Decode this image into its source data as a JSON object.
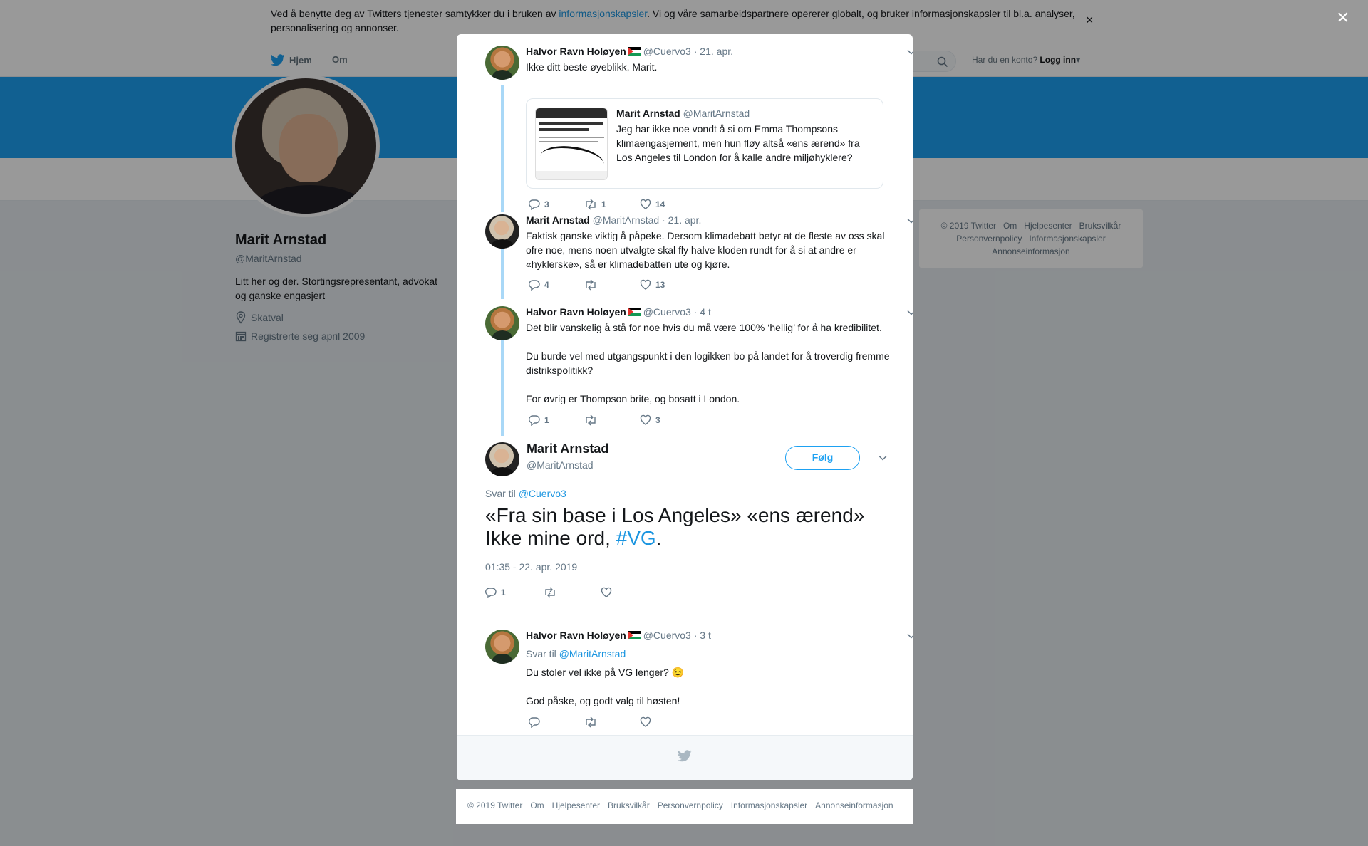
{
  "cookie": {
    "text_before": "Ved å benytte deg av Twitters tjenester samtykker du i bruken av ",
    "link": "informasjonskapsler",
    "text_after": ". Vi og våre samarbeidspartnere opererer globalt, og bruker informasjonskapsler til bl.a. analyser, personalisering og annonser.",
    "close": "×"
  },
  "nav": {
    "home": "Hjem",
    "about": "Om",
    "login_prompt": "Har du en konto?",
    "login": "Logg inn"
  },
  "profile": {
    "name": "Marit Arnstad",
    "handle": "@MaritArnstad",
    "bio": "Litt her og der. Stortingsrepresentant, advokat og ganske engasjert",
    "location": "Skatval",
    "joined": "Registrerte seg april 2009"
  },
  "side_footer": [
    "© 2019 Twitter",
    "Om",
    "Hjelpesenter",
    "Bruksvilkår",
    "Personvernpolicy",
    "Informasjonskapsler",
    "Annonseinformasjon"
  ],
  "overlay_close": "×",
  "tweets": [
    {
      "name": "Halvor Ravn Holøyen",
      "handle": "@Cuervo3",
      "date": "· 21. apr.",
      "text": "Ikke ditt beste øyeblikk, Marit.",
      "quote": {
        "name": "Marit Arnstad",
        "handle": "@MaritArnstad",
        "text": "Jeg har ikke noe vondt å si om Emma Thompsons klimaengasjement, men hun fløy altså «ens ærend» fra Los Angeles til London for å kalle andre miljøhyklere?"
      },
      "replies": "3",
      "retweets": "1",
      "likes": "14"
    },
    {
      "name": "Marit Arnstad",
      "handle": "@MaritArnstad",
      "date": "· 21. apr.",
      "text": "Faktisk ganske viktig å påpeke. Dersom klimadebatt betyr at de fleste av oss skal ofre noe, mens noen utvalgte skal fly halve kloden rundt for å si at andre er «hyklerske», så er klimadebatten ute og kjøre.",
      "replies": "4",
      "retweets": "",
      "likes": "13"
    },
    {
      "name": "Halvor Ravn Holøyen",
      "handle": "@Cuervo3",
      "date": "· 4 t",
      "text1": "Det blir vanskelig å stå for noe hvis du må være 100% ‘hellig’ for å ha kredibilitet.",
      "text2": "Du burde vel med utgangspunkt i den logikken bo på landet for å troverdig fremme distrikspolitikk?",
      "text3": "For øvrig er Thompson brite, og bosatt i London.",
      "replies": "1",
      "retweets": "",
      "likes": "3"
    }
  ],
  "main_tweet": {
    "name": "Marit Arnstad",
    "handle": "@MaritArnstad",
    "follow": "Følg",
    "reply_label": "Svar til",
    "reply_handle": "@Cuervo3",
    "text": "«Fra sin base i Los Angeles» «ens ærend» Ikke mine ord, ",
    "hashtag": "#VG",
    "text_end": ".",
    "time": "01:35 - 22. apr. 2019",
    "replies": "1"
  },
  "reply_tweet": {
    "name": "Halvor Ravn Holøyen",
    "handle": "@Cuervo3",
    "date": "· 3 t",
    "reply_label": "Svar til",
    "reply_handle": "@MaritArnstad",
    "text1": "Du stoler vel ikke på VG lenger? 😉",
    "text2": "God påske, og godt valg til høsten!"
  },
  "bottom_footer": [
    "© 2019 Twitter",
    "Om",
    "Hjelpesenter",
    "Bruksvilkår",
    "Personvernpolicy",
    "Informasjonskapsler",
    "Annonseinformasjon"
  ],
  "colors": {
    "accent": "#1da1f2",
    "link": "#1b95e0",
    "thread": "#a9d8f7"
  }
}
